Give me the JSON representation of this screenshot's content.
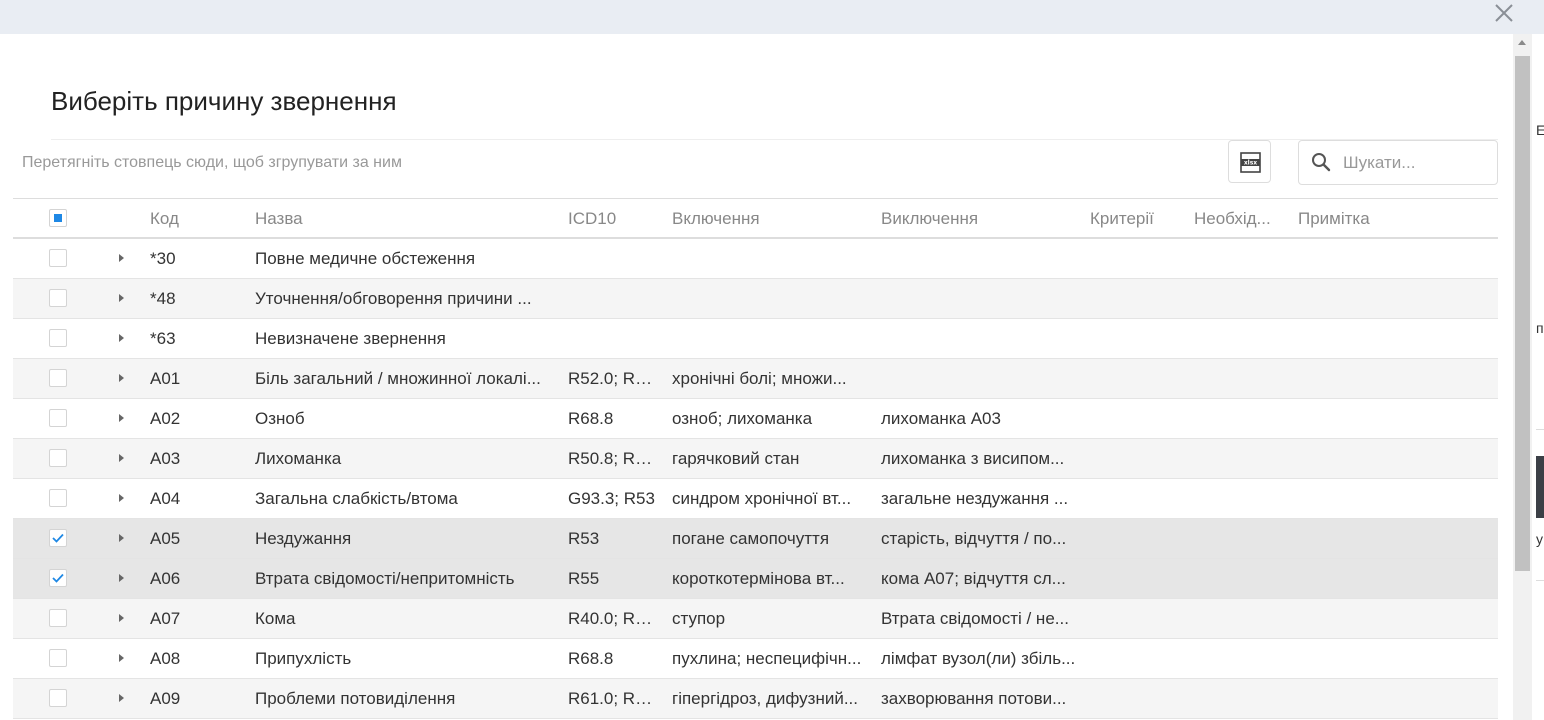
{
  "dialog": {
    "title": "Виберіть причину звернення",
    "group_hint": "Перетягніть стовпець сюди, щоб згрупувати за ним",
    "export_button_icon": "xlsx-icon",
    "search_placeholder": "Шукати...",
    "close_icon": "close-icon"
  },
  "columns": {
    "code": "Код",
    "name": "Назва",
    "icd10": "ICD10",
    "includes": "Включення",
    "excludes": "Виключення",
    "criteria": "Критерії",
    "needed": "Необхід...",
    "note": "Примітка"
  },
  "rows": [
    {
      "code": "*30",
      "name": "Повне медичне обстеження",
      "icd10": "",
      "includes": "",
      "excludes": "",
      "checked": false
    },
    {
      "code": "*48",
      "name": "Уточнення/обговорення причини ...",
      "icd10": "",
      "includes": "",
      "excludes": "",
      "checked": false
    },
    {
      "code": "*63",
      "name": "Невизначене звернення",
      "icd10": "",
      "includes": "",
      "excludes": "",
      "checked": false
    },
    {
      "code": "A01",
      "name": "Біль загальний / множинної локалі...",
      "icd10": "R52.0; R5...",
      "includes": "хронічні болі; множи...",
      "excludes": "",
      "checked": false
    },
    {
      "code": "A02",
      "name": "Озноб",
      "icd10": "R68.8",
      "includes": "озноб; лихоманка",
      "excludes": "лихоманка A03",
      "checked": false
    },
    {
      "code": "A03",
      "name": "Лихоманка",
      "icd10": "R50.8; R5...",
      "includes": "гарячковий стан",
      "excludes": "лихоманка з висипом...",
      "checked": false
    },
    {
      "code": "A04",
      "name": "Загальна слабкість/втома",
      "icd10": "G93.3; R53",
      "includes": "синдром хронічної вт...",
      "excludes": "загальне нездужання ...",
      "checked": false
    },
    {
      "code": "A05",
      "name": "Нездужання",
      "icd10": "R53",
      "includes": "погане самопочуття",
      "excludes": "старість, відчуття / по...",
      "checked": true
    },
    {
      "code": "A06",
      "name": "Втрата свідомості/непритомність",
      "icd10": "R55",
      "includes": "короткотермінова вт...",
      "excludes": "кома A07; відчуття сл...",
      "checked": true
    },
    {
      "code": "A07",
      "name": "Кома",
      "icd10": "R40.0; R4...",
      "includes": "ступор",
      "excludes": "Втрата свідомості / не...",
      "checked": false
    },
    {
      "code": "A08",
      "name": "Припухлість",
      "icd10": "R68.8",
      "includes": "пухлина; неспецифічн...",
      "excludes": "лімфат вузол(ли) збіль...",
      "checked": false
    },
    {
      "code": "A09",
      "name": "Проблеми потовиділення",
      "icd10": "R61.0; R6...",
      "includes": "гіпергідроз, дифузний...",
      "excludes": "захворювання потови...",
      "checked": false
    }
  ],
  "colors": {
    "accent": "#1e88e5",
    "row_selected": "#e6e6e6",
    "row_alt": "#f5f5f5"
  }
}
